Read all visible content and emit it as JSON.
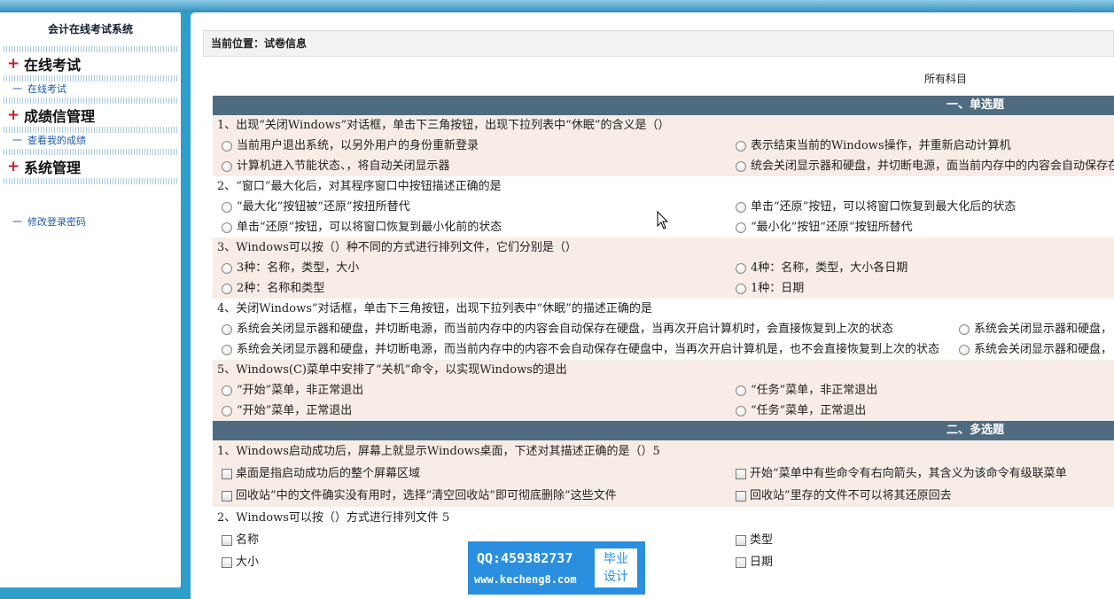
{
  "sidebar": {
    "title": "会计在线考试系统",
    "groups": [
      {
        "label": "在线考试",
        "items": [
          "在线考试"
        ]
      },
      {
        "label": "成绩信管理",
        "items": [
          "查看我的成绩"
        ]
      },
      {
        "label": "系统管理",
        "items": []
      }
    ],
    "extra_item": "修改登录密码",
    "dash": "一",
    "plus": "+"
  },
  "main": {
    "breadcrumb": "当前位置：试卷信息",
    "subject": "所有科目",
    "sections": [
      {
        "title": "一、单选题",
        "questions": [
          {
            "title": "1、出现“关闭Windows”对话框，单击下三角按钮，出现下拉列表中“休眠”的含义是（）",
            "options": [
              "当前用户退出系统，以另外用户的身份重新登录",
              "表示结束当前的Windows操作，并重新启动计算机",
              "计算机进入节能状态、，将自动关闭显示器",
              "统会关闭显示器和硬盘，并切断电源，面当前内存中的内容会自动保存在"
            ]
          },
          {
            "title": "2、“窗口”最大化后，对其程序窗口中按钮描述正确的是",
            "options": [
              "“最大化”按钮被“还原”按扭所替代",
              "单击“还原”按钮，可以将窗口恢复到最大化后的状态",
              "单击“还原”按钮，可以将窗口恢复到最小化前的状态",
              "“最小化”按钮“还原”按钮所替代"
            ]
          },
          {
            "title": "3、Windows可以按（）种不同的方式进行排列文件，它们分别是（）",
            "options": [
              "3种：名称，类型，大小",
              "4种：名称，类型，大小各日期",
              "2种：名称和类型",
              "1种：日期"
            ]
          },
          {
            "title": "4、关闭Windows”对话框，单击下三角按钮，出现下拉列表中“休眠”的描述正确的是",
            "options": [
              "系统会关闭显示器和硬盘，并切断电源，而当前内存中的内容会自动保存在硬盘，当再次开启计算机时，会直接恢复到上次的状态",
              "系统会关闭显示器和硬盘，",
              "系统会关闭显示器和硬盘，并切断电源，而当前内存中的内容不会自动保存在硬盘中，当再次开启计算机是，也不会直接恢复到上次的状态",
              "系统会关闭显示器和硬盘，"
            ]
          },
          {
            "title": "5、Windows(C)菜单中安排了“关机”命令，以实现Windows的退出",
            "options": [
              "“开始”菜单，非正常退出",
              "“任务”菜单，非正常退出",
              "“开始”菜单，正常退出",
              "“任务”菜单，正常退出"
            ]
          }
        ]
      },
      {
        "title": "二、多选题",
        "questions": [
          {
            "title": "1、Windows启动成功后，屏幕上就显示Windows桌面，下述对其描述正确的是（）5",
            "options": [
              "桌面是指启动成功后的整个屏幕区域",
              "开始“菜单中有些命令有右向箭头，其含义为该命令有级联菜单",
              "回收站”中的文件确实没有用时，选择”清空回收站”即可彻底删除”这些文件",
              "回收站”里存的文件不可以将其还原回去"
            ]
          },
          {
            "title": "2、Windows可以按（）方式进行排列文件 5",
            "options": [
              "名称",
              "类型",
              "大小",
              "日期"
            ]
          }
        ]
      }
    ]
  },
  "watermark": {
    "qq": "QQ:459382737",
    "url": "www.kecheng8.com",
    "badge_line1": "毕业",
    "badge_line2": "设计"
  }
}
